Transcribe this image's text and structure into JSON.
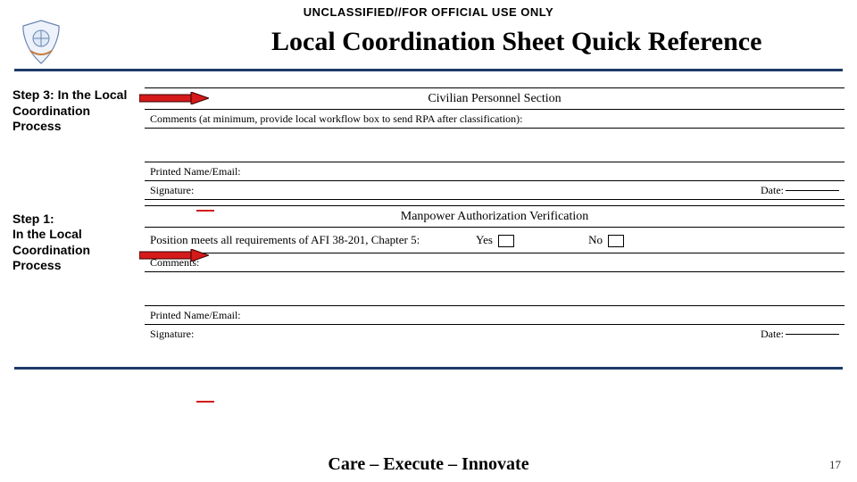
{
  "classification": "UNCLASSIFIED//FOR OFFICIAL USE ONLY",
  "title": "Local Coordination Sheet Quick Reference",
  "notes": {
    "step3": "Step 3: In the Local Coordination Process",
    "step1": "Step 1:\nIn the Local Coordination Process"
  },
  "form": {
    "section1_title": "Civilian Personnel Section",
    "comments_instr": "Comments (at minimum, provide local workflow box to send RPA after classification):",
    "printed_label": "Printed Name/Email:",
    "signature_label": "Signature:",
    "date_label": "Date:",
    "section2_title": "Manpower Authorization Verification",
    "question": "Position meets all requirements of AFI 38-201, Chapter 5:",
    "yes": "Yes",
    "no": "No",
    "comments2_label": "Comments:"
  },
  "footer": {
    "motto": "Care – Execute – Innovate",
    "page": "17"
  }
}
